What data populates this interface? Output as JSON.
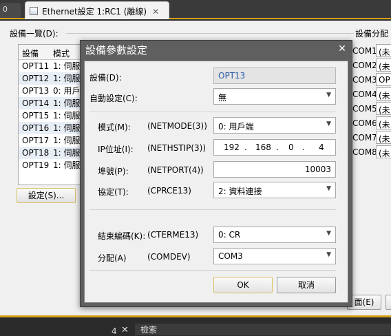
{
  "tabs": {
    "prev_label": "0",
    "active_label": "Ethernet設定 1:RC1 (離線)"
  },
  "main": {
    "device_list_label": "設備一覽(D):",
    "assignment_label": "設備分配",
    "list": {
      "headers": [
        "設備",
        "模式"
      ],
      "rows": [
        {
          "device": "OPT11",
          "mode": "1: 伺服"
        },
        {
          "device": "OPT12",
          "mode": "1: 伺服"
        },
        {
          "device": "OPT13",
          "mode": "0: 用戶"
        },
        {
          "device": "OPT14",
          "mode": "1: 伺服"
        },
        {
          "device": "OPT15",
          "mode": "1: 伺服"
        },
        {
          "device": "OPT16",
          "mode": "1: 伺服"
        },
        {
          "device": "OPT17",
          "mode": "1: 伺服"
        },
        {
          "device": "OPT18",
          "mode": "1: 伺服"
        },
        {
          "device": "OPT19",
          "mode": "1: 伺服"
        }
      ]
    },
    "settings_button": "設定(S)...",
    "com_rows": [
      {
        "label": "COM1:",
        "value": "(未"
      },
      {
        "label": "COM2:",
        "value": "(未"
      },
      {
        "label": "COM3:",
        "value": "OP"
      },
      {
        "label": "COM4:",
        "value": "(未"
      },
      {
        "label": "COM5:",
        "value": "(未"
      },
      {
        "label": "COM6:",
        "value": "(未"
      },
      {
        "label": "COM7:",
        "value": "(未"
      },
      {
        "label": "COM8:",
        "value": "(未"
      }
    ],
    "face_button": "面(E)"
  },
  "bottom": {
    "pin": "4",
    "close": "✕",
    "tab_label": "檢索"
  },
  "dialog": {
    "title": "設備參數設定",
    "close": "✕",
    "device_label": "設備(D):",
    "device_value": "OPT13",
    "auto_label": "自動設定(C):",
    "auto_value": "無",
    "mode_label": "模式(M):",
    "mode_param": "(NETMODE(3))",
    "mode_value": "0: 用戶端",
    "ip_label": "IP位址(I):",
    "ip_param": "(NETHSTIP(3))",
    "ip_octets": [
      "192",
      "168",
      "0",
      "4"
    ],
    "ip_dot": ".",
    "port_label": "埠號(P):",
    "port_param": "(NETPORT(4))",
    "port_value": "10003",
    "proto_label": "協定(T):",
    "proto_param": "(CPRCE13)",
    "proto_value": "2: 資料連接",
    "term_label": "結束編碼(K):",
    "term_param": "(CTERME13)",
    "term_value": "0: CR",
    "assign_label": "分配(A)",
    "assign_param": "(COMDEV)",
    "assign_value": "COM3",
    "ok": "OK",
    "cancel": "取消"
  }
}
